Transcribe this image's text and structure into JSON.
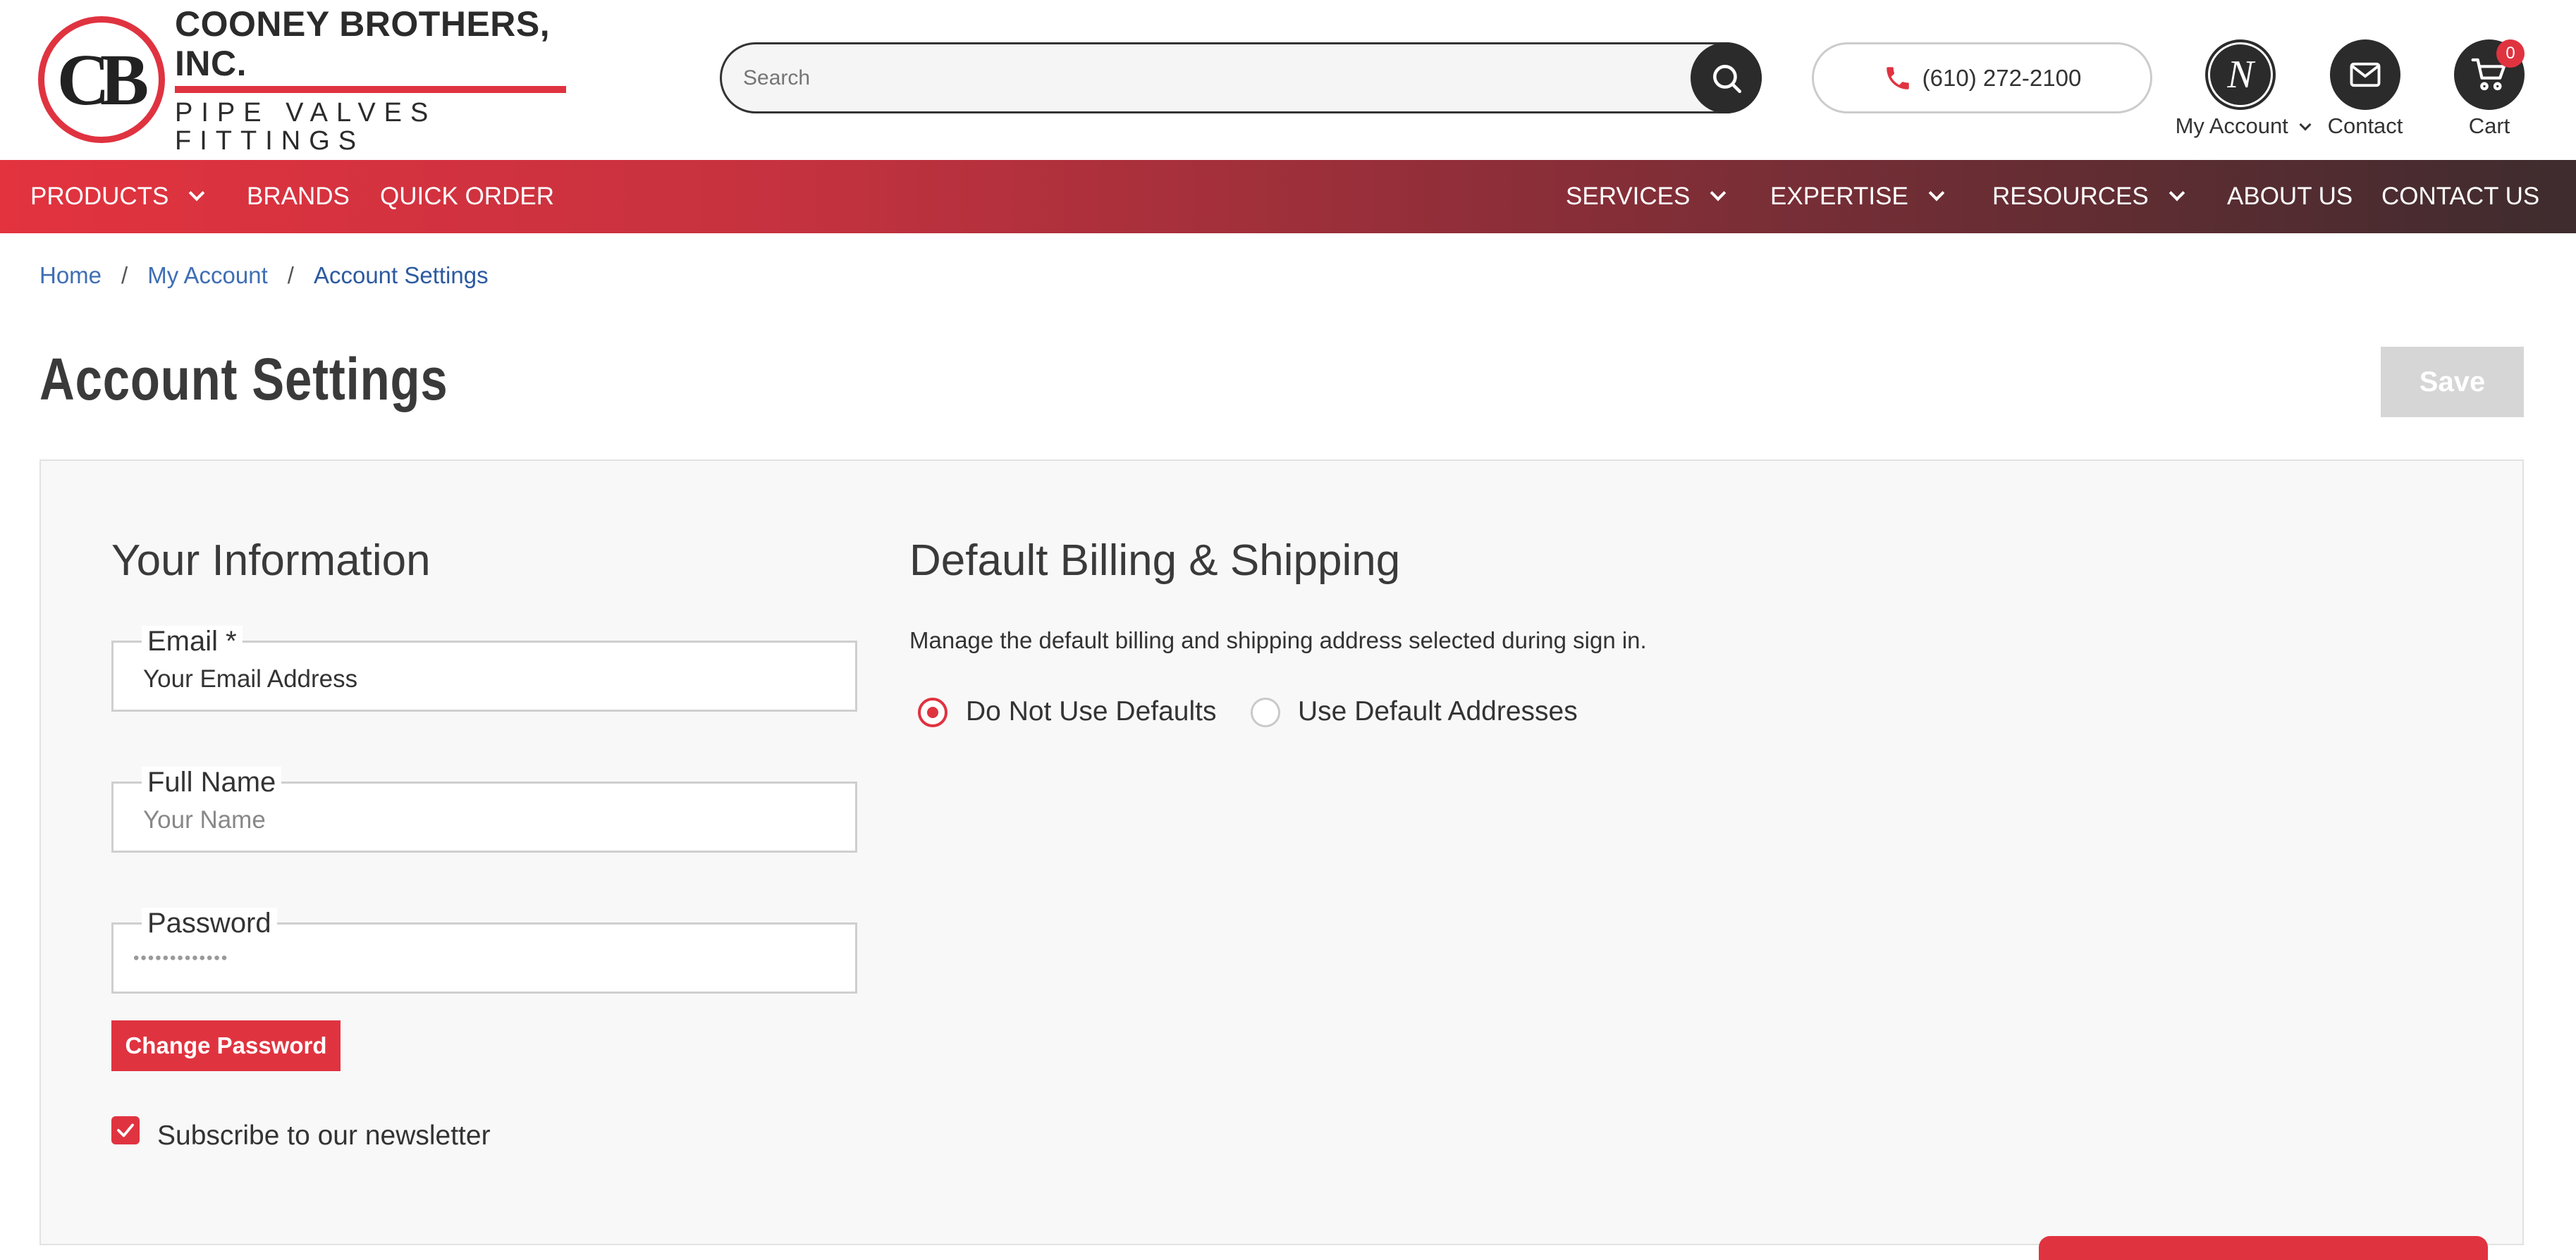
{
  "brand": {
    "logo_initials": "CB",
    "logo_line1": "COONEY BROTHERS, INC.",
    "logo_line2": "PIPE VALVES FITTINGS",
    "accent_color": "#e03340"
  },
  "header": {
    "search_placeholder": "Search",
    "phone": "(610) 272-2100",
    "account_initial": "N",
    "account_label": "My Account",
    "contact_label": "Contact",
    "cart_label": "Cart",
    "cart_count": "0"
  },
  "nav": {
    "products": "PRODUCTS",
    "brands": "BRANDS",
    "quick_order": "QUICK ORDER",
    "services": "SERVICES",
    "expertise": "EXPERTISE",
    "resources": "RESOURCES",
    "about": "ABOUT US",
    "contact": "CONTACT US"
  },
  "breadcrumb": {
    "home": "Home",
    "separator": "/",
    "account": "My Account",
    "current": "Account Settings"
  },
  "page": {
    "title": "Account Settings",
    "save_label": "Save"
  },
  "info": {
    "title": "Your Information",
    "email_label": "Email *",
    "email_value": "Your Email Address",
    "name_label": "Full Name",
    "name_placeholder": "Your Name",
    "password_label": "Password",
    "password_mask": "•••••••••••••",
    "change_password": "Change Password",
    "newsletter_label": "Subscribe to our newsletter",
    "newsletter_checked": true
  },
  "billing": {
    "title": "Default Billing & Shipping",
    "description": "Manage the default billing and shipping address selected during sign in.",
    "option_none": "Do Not Use Defaults",
    "option_default": "Use Default Addresses",
    "selected": "Do Not Use Defaults"
  }
}
